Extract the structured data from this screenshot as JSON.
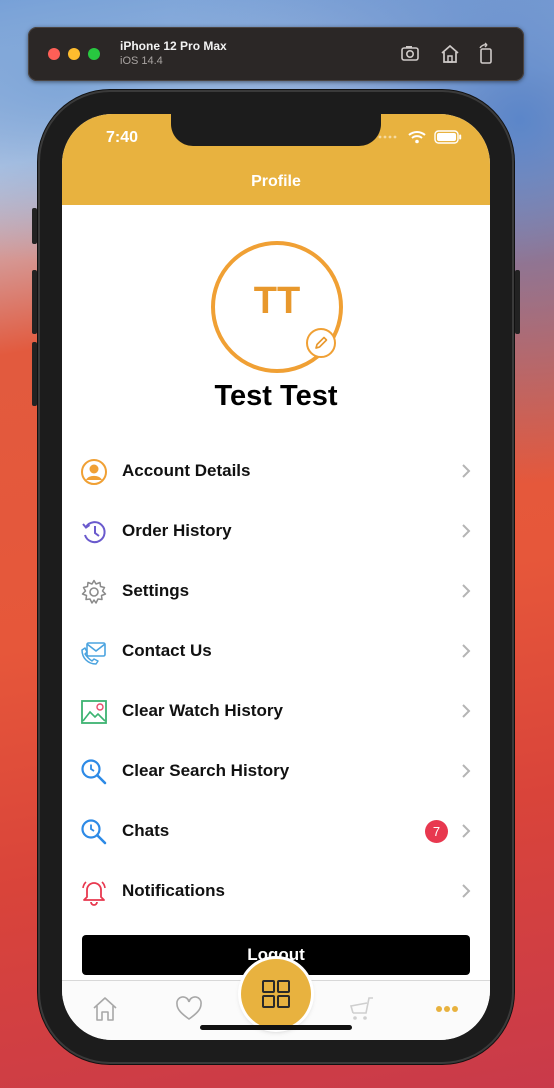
{
  "simulator": {
    "device": "iPhone 12 Pro Max",
    "os": "iOS 14.4"
  },
  "status_bar": {
    "time": "7:40"
  },
  "nav": {
    "title": "Profile"
  },
  "profile": {
    "initials": "TT",
    "name": "Test Test"
  },
  "menu": {
    "items": [
      {
        "label": "Account Details",
        "icon": "user-circle-icon"
      },
      {
        "label": "Order History",
        "icon": "history-icon"
      },
      {
        "label": "Settings",
        "icon": "gear-icon"
      },
      {
        "label": "Contact Us",
        "icon": "mail-phone-icon"
      },
      {
        "label": "Clear Watch History",
        "icon": "image-history-icon"
      },
      {
        "label": "Clear Search History",
        "icon": "search-icon"
      },
      {
        "label": "Chats",
        "icon": "search-icon",
        "badge": "7"
      },
      {
        "label": "Notifications",
        "icon": "bell-icon"
      }
    ]
  },
  "logout_label": "Logout",
  "tabs": [
    "home",
    "favorites",
    "categories",
    "cart",
    "more"
  ],
  "colors": {
    "accent": "#e8b23f",
    "avatar_ring": "#f0a034",
    "badge": "#e8384f"
  }
}
